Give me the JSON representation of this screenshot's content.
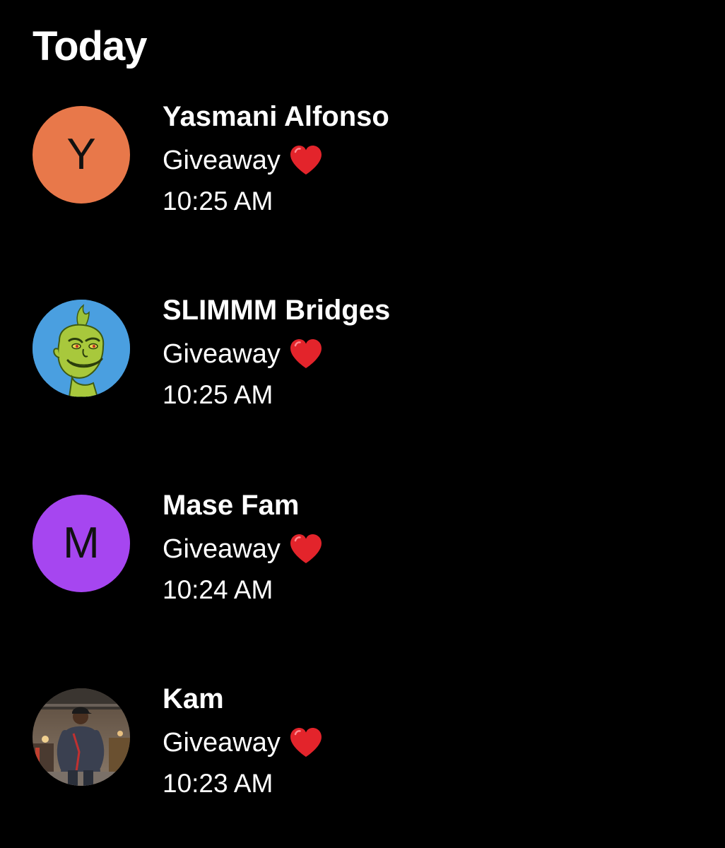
{
  "section": {
    "title": "Today"
  },
  "colors": {
    "background": "#000000",
    "text": "#ffffff",
    "heart": "#e3242b",
    "avatar_y": "#e8784a",
    "avatar_m": "#a646f0",
    "avatar_grinch_bg": "#4a9fe0"
  },
  "messages": [
    {
      "name": "Yasmani Alfonso",
      "text": "Giveaway",
      "emoji": "red-heart-icon",
      "time": "10:25 AM",
      "avatar_letter": "Y",
      "avatar_color": "#e8784a"
    },
    {
      "name": "SLIMMM Bridges",
      "text": "Giveaway",
      "emoji": "red-heart-icon",
      "time": "10:25 AM",
      "avatar_image": "grinch-avatar"
    },
    {
      "name": "Mase Fam",
      "text": "Giveaway",
      "emoji": "red-heart-icon",
      "time": "10:24 AM",
      "avatar_letter": "M",
      "avatar_color": "#a646f0"
    },
    {
      "name": "Kam",
      "text": "Giveaway",
      "emoji": "red-heart-icon",
      "time": "10:23 AM",
      "avatar_image": "person-photo-avatar"
    }
  ]
}
